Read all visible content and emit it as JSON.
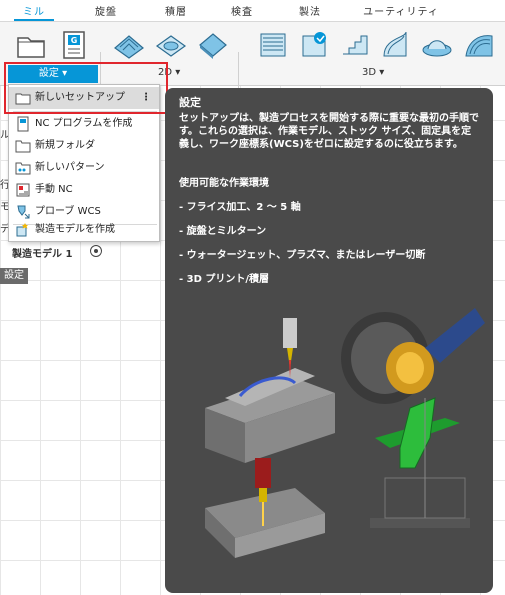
{
  "ribbon": {
    "tabs": [
      "ミル",
      "旋盤",
      "積層",
      "検査",
      "製法",
      "ユーティリティ"
    ],
    "active_tab": "ミル",
    "setup_group_label": "設定 ▾",
    "group_2d_label": "2D ▾",
    "group_3d_label": "3D ▾",
    "tool_icons": [
      "new-setup-icon",
      "nc-program-icon",
      "2d-adaptive-icon",
      "2d-pocket-icon",
      "face-icon",
      "3d-adaptive-icon",
      "3d-pocket-icon",
      "steep-shallow-icon",
      "flow-icon",
      "radial-icon",
      "spiral-icon"
    ]
  },
  "dropdown": {
    "items": [
      {
        "label": "新しいセットアップ",
        "icon": "setup-folder-icon",
        "more": "⋮"
      },
      {
        "label": "NC プログラムを作成",
        "icon": "nc-program-icon"
      },
      {
        "label": "新規フォルダ",
        "icon": "folder-icon"
      },
      {
        "label": "新しいパターン",
        "icon": "pattern-icon"
      },
      {
        "label": "手動 NC",
        "icon": "manual-nc-icon"
      },
      {
        "label": "プローブ WCS",
        "icon": "probe-wcs-icon"
      },
      {
        "label": "製造モデルを作成",
        "icon": "manufacturing-model-icon"
      }
    ]
  },
  "browser": {
    "partial_labels": [
      "ル",
      "行",
      "モ",
      "デ"
    ],
    "mfg_model": "製造モデル 1",
    "setup_badge": "設定"
  },
  "tooltip": {
    "title": "設定",
    "description": "セットアップは、製造プロセスを開始する際に重要な最初の手順です。これらの選択は、作業モデル、ストック サイズ、固定具を定義し、ワーク座標系(WCS)をゼロに設定するのに役立ちます。",
    "heading": "使用可能な作業環境",
    "bullets": [
      "- フライス加工、2 ～ 5 軸",
      "- 旋盤とミルターン",
      "- ウォータージェット、プラズマ、またはレーザー切断",
      "- 3D プリント/積層"
    ]
  },
  "colors": {
    "accent": "#0696d7",
    "highlight": "#e0262d",
    "tooltip_bg": "#4a4a4a"
  }
}
